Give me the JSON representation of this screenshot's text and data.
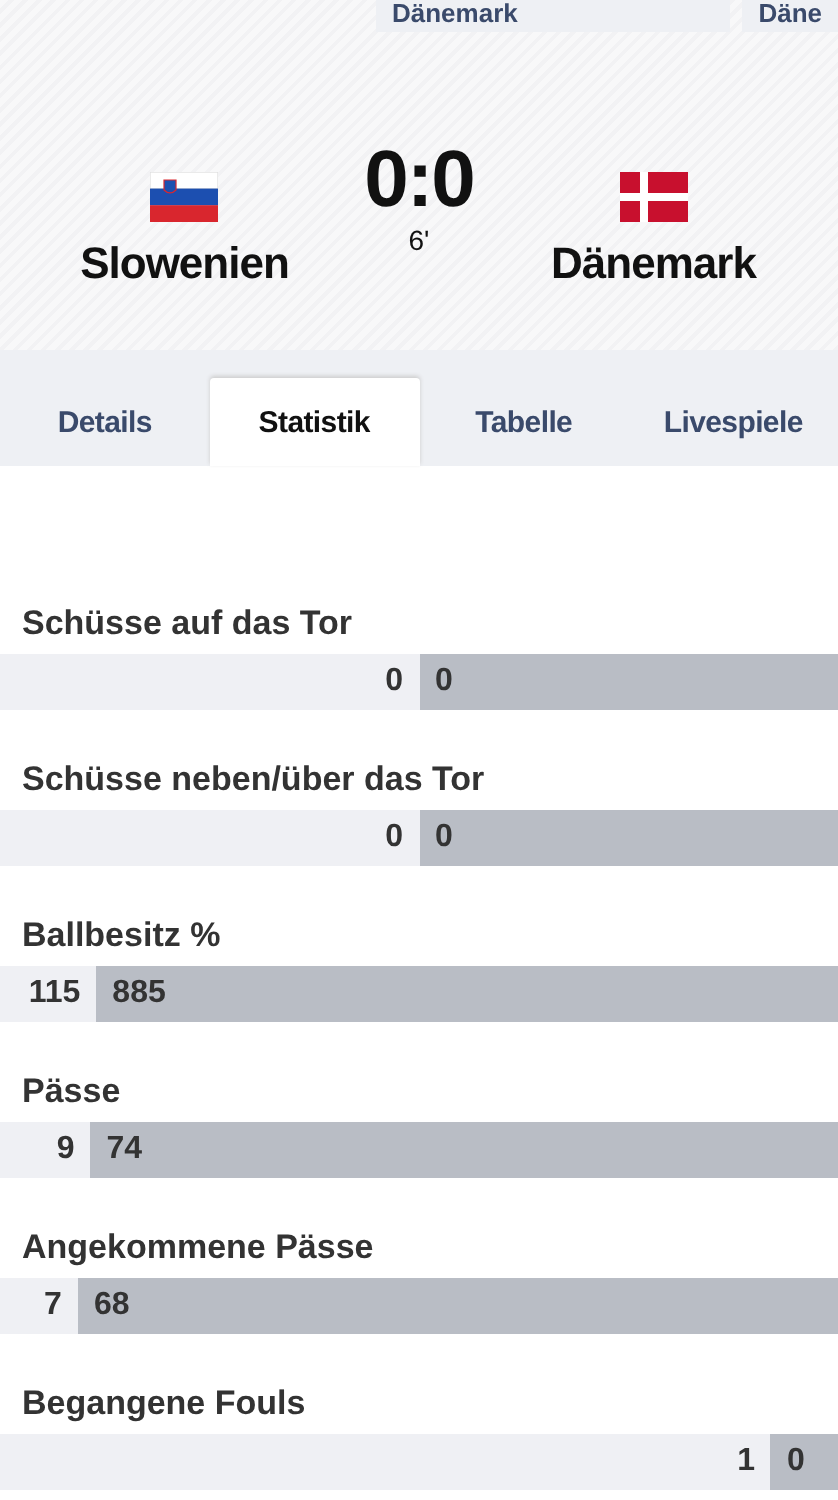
{
  "top_boxes": [
    "Dänemark",
    "Däne"
  ],
  "match": {
    "home": {
      "name": "Slowenien",
      "flag": {
        "kind": "slovenia"
      }
    },
    "score": "0:0",
    "minute": "6'",
    "away": {
      "name": "Dänemark",
      "flag": {
        "kind": "denmark"
      }
    }
  },
  "tabs": [
    {
      "label": "Details",
      "selected": false
    },
    {
      "label": "Statistik",
      "selected": true
    },
    {
      "label": "Tabelle",
      "selected": false
    },
    {
      "label": "Livespiele",
      "selected": false
    }
  ],
  "stats": [
    {
      "label": "Schüsse auf das Tor",
      "home": "0",
      "away": "0",
      "level": 0.5
    },
    {
      "label": "Schüsse neben/über das Tor",
      "home": "0",
      "away": "0",
      "level": 0.5
    },
    {
      "label": "Ballbesitz %",
      "home": "115",
      "away": "885",
      "level": 0.115
    },
    {
      "label": "Pässe",
      "home": "9",
      "away": "74",
      "level": 0.108
    },
    {
      "label": "Angekommene Pässe",
      "home": "7",
      "away": "68",
      "level": 0.093
    },
    {
      "label": "Begangene Fouls",
      "home": "1",
      "away": "0",
      "level": 0.92
    }
  ]
}
